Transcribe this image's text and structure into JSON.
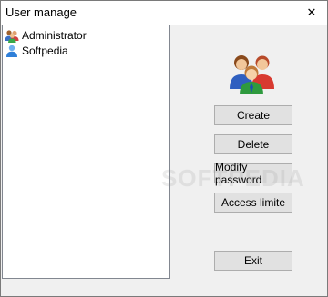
{
  "window": {
    "title": "User manage",
    "close_glyph": "✕"
  },
  "user_list": {
    "items": [
      {
        "label": "Administrator",
        "icon": "admin-users-icon"
      },
      {
        "label": "Softpedia",
        "icon": "user-icon"
      }
    ]
  },
  "buttons": {
    "create": "Create",
    "delete": "Delete",
    "modify_password": "Modify password",
    "access_limite": "Access limite",
    "exit": "Exit"
  },
  "watermark": "SOFTPEDIA"
}
